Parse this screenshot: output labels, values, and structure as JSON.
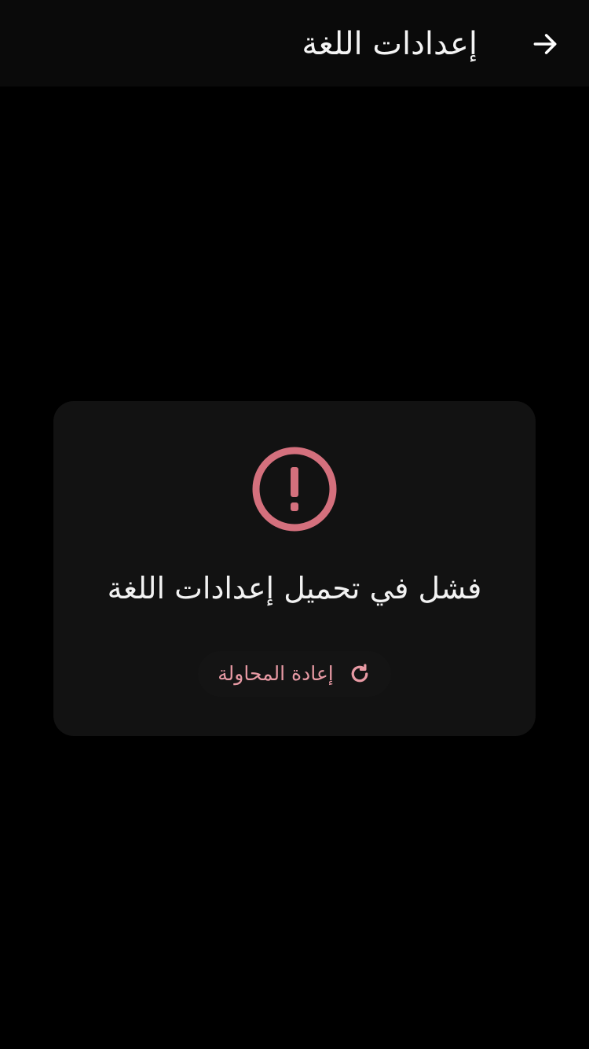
{
  "app_bar": {
    "title": "إعدادات اللغة",
    "back_icon": "arrow-right-icon",
    "background": "#0a0a0a",
    "title_color": "#f4f4f4"
  },
  "error_card": {
    "icon": "alert-circle-icon",
    "icon_color": "#d4707d",
    "message": "فشل في تحميل إعدادات اللغة",
    "card_background": "#121212",
    "retry_button": {
      "label": "إعادة المحاولة",
      "icon": "refresh-icon",
      "color": "#e89aa4"
    }
  },
  "page_background": "#000000"
}
